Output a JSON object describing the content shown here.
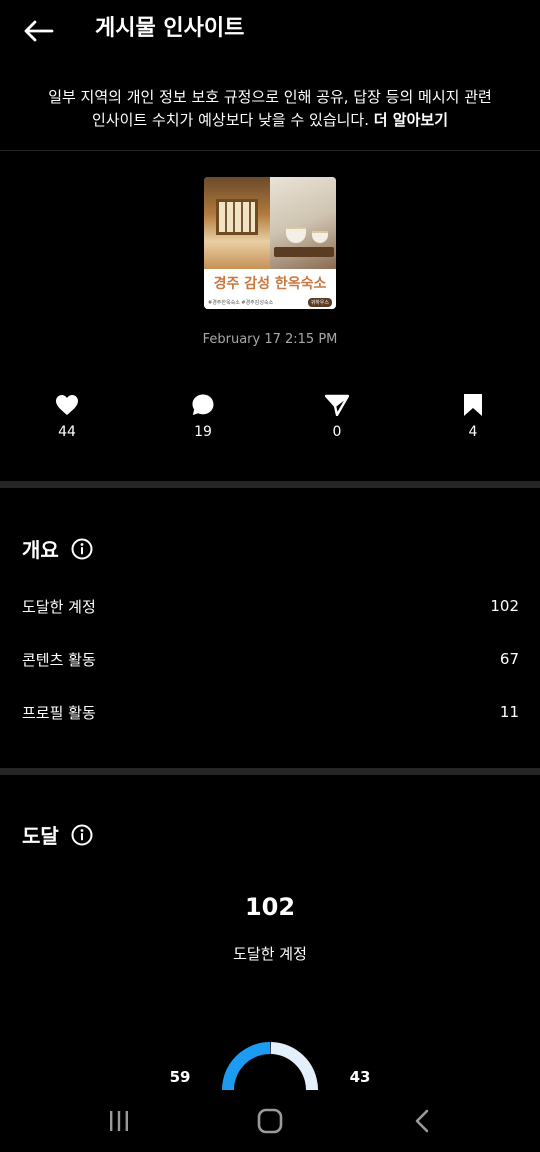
{
  "header": {
    "title": "게시물 인사이트",
    "back_icon": "arrow-left-icon"
  },
  "notice": {
    "line1": "일부 지역의 개인 정보 보호 규정으로 인해 공유, 답장 등의 메시지 관련",
    "line2": "인사이트 수치가 예상보다 낮을 수 있습니다. ",
    "link": "더 알아보기"
  },
  "post": {
    "image_title": "경주 감성 한옥숙소",
    "image_subtitle": "#경주한옥숙소 #경주감성숙소",
    "image_badge": "귀하우스",
    "timestamp": "February 17 2:15 PM"
  },
  "stats": [
    {
      "icon": "heart-icon",
      "value": "44"
    },
    {
      "icon": "comment-icon",
      "value": "19"
    },
    {
      "icon": "share-icon",
      "value": "0"
    },
    {
      "icon": "bookmark-icon",
      "value": "4"
    }
  ],
  "overview": {
    "title": "개요",
    "rows": [
      {
        "label": "도달한 계정",
        "value": "102"
      },
      {
        "label": "콘텐츠 활동",
        "value": "67"
      },
      {
        "label": "프로필 활동",
        "value": "11"
      }
    ]
  },
  "reach": {
    "title": "도달",
    "value": "102",
    "label": "도달한 계정",
    "left_value": "59",
    "right_value": "43",
    "left_fraction": 0.578,
    "colors": {
      "followers": "#1d9bf0",
      "non_followers": "#e3f0fb"
    }
  },
  "navbar": {
    "icons": [
      "recent-apps-icon",
      "home-icon",
      "back-icon"
    ]
  }
}
